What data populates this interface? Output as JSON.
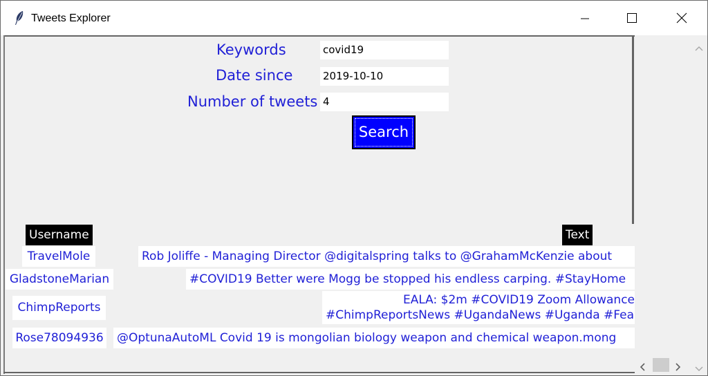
{
  "window": {
    "title": "Tweets Explorer"
  },
  "form": {
    "keywords": {
      "label": "Keywords",
      "value": "covid19"
    },
    "date_since": {
      "label": "Date since",
      "value": "2019-10-10"
    },
    "num_tweets": {
      "label": "Number of tweets",
      "value": "4"
    },
    "search_label": "Search"
  },
  "table": {
    "columns": [
      "Username",
      "Text"
    ],
    "rows": [
      {
        "username": "TravelMole",
        "text": [
          "Rob Joliffe - Managing Director @digitalspring talks to @GrahamMcKenzie about"
        ]
      },
      {
        "username": "GladstoneMarian",
        "text": [
          "#COVID19 Better were Mogg be stopped his endless carping. #StayHome"
        ]
      },
      {
        "username": "ChimpReports",
        "text": [
          "EALA: $2m #COVID19 Zoom Allowance",
          "#ChimpReportsNews #UgandaNews #Uganda #Fea"
        ]
      },
      {
        "username": "Rose78094936",
        "text": [
          "@OptunaAutoML Covid 19 is mongolian biology weapon and chemical weapon.mong"
        ]
      }
    ]
  },
  "colors": {
    "label_text": "#1f1fd6",
    "search_button": "#0000ff",
    "header_bg": "#000000"
  },
  "icons": [
    "feather-icon",
    "minimize-icon",
    "maximize-icon",
    "close-icon",
    "scroll-up-icon",
    "scroll-down-icon",
    "scroll-left-icon",
    "scroll-right-icon"
  ]
}
